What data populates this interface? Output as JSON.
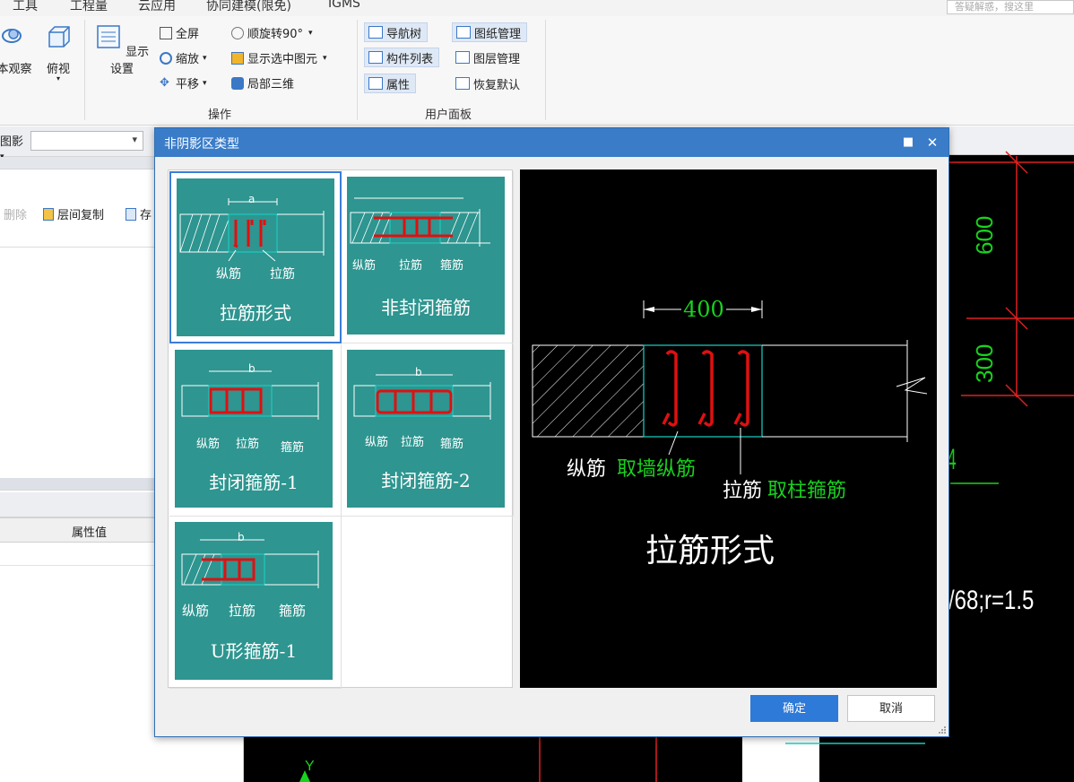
{
  "menu": {
    "items": [
      "工具",
      "工程量",
      "云应用",
      "协同建模(限免)",
      "IGMS"
    ],
    "search_placeholder": "答疑解惑，搜这里"
  },
  "ribbon": {
    "view_buttons": [
      "本观察",
      "俯视"
    ],
    "display_settings": "显示设置",
    "ops": {
      "fullscreen": "全屏",
      "zoom": "缩放",
      "pan": "平移",
      "rotate": "顺旋转90°",
      "show_selected": "显示选中图元",
      "local_3d": "局部三维"
    },
    "ops_group_label": "操作",
    "panels": {
      "nav_tree": "导航树",
      "component_list": "构件列表",
      "properties": "属性",
      "drawing_mgmt": "图纸管理",
      "layer_mgmt": "图层管理",
      "restore_default": "恢复默认"
    },
    "panels_group_label": "用户面板"
  },
  "left_pane": {
    "combo_label": "图影",
    "toolbar": {
      "delete": "删除",
      "copy_floor": "层间复制",
      "more": "存"
    },
    "prop_value_header": "属性值"
  },
  "cad": {
    "dims": [
      "600",
      "300"
    ],
    "label_4": "4",
    "formula": "/68;r=1.5"
  },
  "dialog": {
    "title": "非阴影区类型",
    "tiles": [
      {
        "name": "拉筋形式",
        "selected": true
      },
      {
        "name": "非封闭箍筋",
        "selected": false
      },
      {
        "name": "封闭箍筋-1",
        "selected": false
      },
      {
        "name": "封闭箍筋-2",
        "selected": false
      },
      {
        "name": "U形箍筋-1",
        "selected": false
      }
    ],
    "tile_labels": {
      "longitudinal": "纵筋",
      "tie": "拉筋",
      "stirrup": "箍筋",
      "dim_a": "a",
      "dim_b": "b"
    },
    "preview": {
      "dimension": "400",
      "long_bar_label": "纵筋",
      "long_bar_note": "取墙纵筋",
      "tie_label": "拉筋",
      "tie_note": "取柱箍筋",
      "title": "拉筋形式"
    },
    "ok": "确定",
    "cancel": "取消"
  },
  "colors": {
    "dialog_title_bg": "#3a7cc8",
    "tile_bg": "#2e9590",
    "ok_button": "#2d7ad8",
    "rebar_red": "#e01010",
    "dim_green": "#19d21e",
    "cad_red": "#e02020"
  }
}
